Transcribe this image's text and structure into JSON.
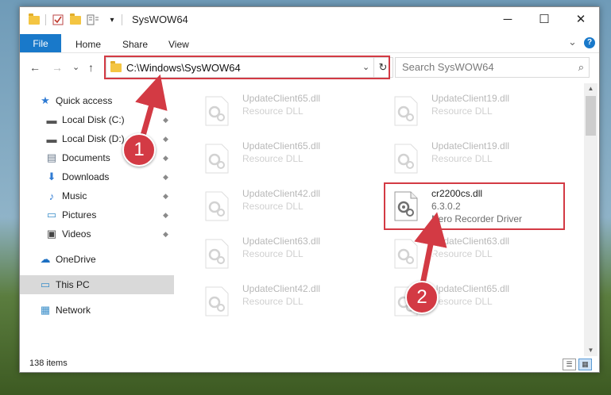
{
  "window": {
    "title": "SysWOW64",
    "minimize_glyph": "─",
    "maximize_glyph": "☐",
    "close_glyph": "✕",
    "qat_dropdown_glyph": "▾"
  },
  "ribbon": {
    "tabs": [
      "File",
      "Home",
      "Share",
      "View"
    ],
    "expand_glyph": "⌄",
    "help_glyph": "?"
  },
  "nav": {
    "back_glyph": "←",
    "forward_glyph": "→",
    "recent_glyph": "⌄",
    "up_glyph": "↑",
    "address": "C:\\Windows\\SysWOW64",
    "address_dropdown_glyph": "⌄",
    "refresh_glyph": "↻",
    "search_placeholder": "Search SysWOW64",
    "search_glyph": "⌕"
  },
  "sidebar": {
    "items": [
      {
        "label": "Quick access",
        "icon": "star-icon",
        "glyph": "★",
        "color": "#2f7bd3",
        "pinned": false
      },
      {
        "label": "Local Disk (C:)",
        "icon": "drive-icon",
        "glyph": "▬",
        "color": "#555555",
        "pinned": true
      },
      {
        "label": "Local Disk (D:)",
        "icon": "drive-icon",
        "glyph": "▬",
        "color": "#555555",
        "pinned": true
      },
      {
        "label": "Documents",
        "icon": "documents-icon",
        "glyph": "▤",
        "color": "#6b7a8c",
        "pinned": true
      },
      {
        "label": "Downloads",
        "icon": "downloads-icon",
        "glyph": "⬇",
        "color": "#2f7bd3",
        "pinned": true
      },
      {
        "label": "Music",
        "icon": "music-icon",
        "glyph": "♪",
        "color": "#2f7bd3",
        "pinned": true
      },
      {
        "label": "Pictures",
        "icon": "pictures-icon",
        "glyph": "▭",
        "color": "#3a8ec9",
        "pinned": true
      },
      {
        "label": "Videos",
        "icon": "videos-icon",
        "glyph": "▣",
        "color": "#444444",
        "pinned": true
      },
      {
        "label": "OneDrive",
        "icon": "onedrive-icon",
        "glyph": "☁",
        "color": "#1c6fc2",
        "pinned": false
      },
      {
        "label": "This PC",
        "icon": "this-pc-icon",
        "glyph": "▭",
        "color": "#3a8ec9",
        "pinned": false,
        "selected": true
      },
      {
        "label": "Network",
        "icon": "network-icon",
        "glyph": "▦",
        "color": "#3a8ec9",
        "pinned": false
      }
    ],
    "pin_glyph": "📌"
  },
  "files": [
    {
      "name": "UpdateClient65.dll",
      "type": "Resource DLL",
      "faded": true
    },
    {
      "name": "UpdateClient19.dll",
      "type": "Resource DLL",
      "faded": true
    },
    {
      "name": "UpdateClient65.dll",
      "type": "Resource DLL",
      "faded": true
    },
    {
      "name": "UpdateClient19.dll",
      "type": "Resource DLL",
      "faded": true
    },
    {
      "name": "UpdateClient42.dll",
      "type": "Resource DLL",
      "faded": true
    },
    {
      "name": "cr2200cs.dll",
      "type": "6.3.0.2",
      "desc": "Nero Recorder Driver",
      "faded": false,
      "highlighted": true
    },
    {
      "name": "UpdateClient63.dll",
      "type": "Resource DLL",
      "faded": true
    },
    {
      "name": "UpdateClient63.dll",
      "type": "Resource DLL",
      "faded": true
    },
    {
      "name": "UpdateClient42.dll",
      "type": "Resource DLL",
      "faded": true
    },
    {
      "name": "UpdateClient65.dll",
      "type": "Resource DLL",
      "faded": true
    }
  ],
  "status": {
    "item_count": "138 items"
  },
  "callouts": [
    "1",
    "2"
  ],
  "colors": {
    "accent": "#1979ca",
    "highlight_red": "#d33a44",
    "selected_bg": "#d9d9d9"
  }
}
